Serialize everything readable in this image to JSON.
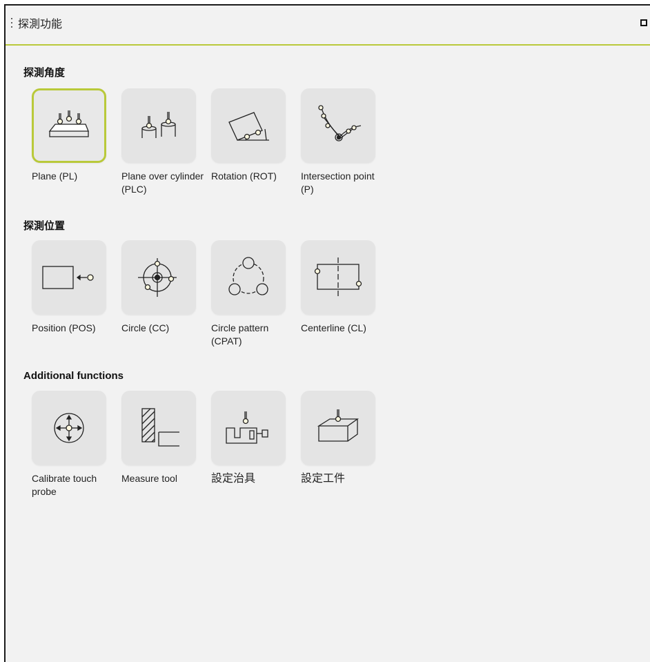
{
  "window": {
    "title": "探測功能",
    "handle_icon": "drag-handle-icon",
    "maximize_icon": "maximize-icon"
  },
  "sections": [
    {
      "title": "探測角度",
      "tiles": [
        {
          "label": "Plane (PL)",
          "icon": "plane-probe-icon",
          "selected": true
        },
        {
          "label": "Plane over cylinder (PLC)",
          "icon": "plane-over-cylinder-icon"
        },
        {
          "label": "Rotation (ROT)",
          "icon": "rotation-probe-icon"
        },
        {
          "label": "Intersection point (P)",
          "icon": "intersection-point-icon"
        }
      ]
    },
    {
      "title": "探測位置",
      "tiles": [
        {
          "label": "Position (POS)",
          "icon": "position-probe-icon"
        },
        {
          "label": "Circle (CC)",
          "icon": "circle-probe-icon"
        },
        {
          "label": "Circle pattern (CPAT)",
          "icon": "circle-pattern-icon"
        },
        {
          "label": "Centerline (CL)",
          "icon": "centerline-probe-icon"
        }
      ]
    },
    {
      "title": "Additional functions",
      "tiles": [
        {
          "label": "Calibrate touch probe",
          "icon": "calibrate-probe-icon"
        },
        {
          "label": "Measure tool",
          "icon": "measure-tool-icon"
        },
        {
          "label": "設定治具",
          "icon": "setup-fixture-icon"
        },
        {
          "label": "設定工件",
          "icon": "setup-workpiece-icon"
        }
      ]
    }
  ],
  "colors": {
    "accent": "#b9c93a",
    "panel_bg": "#f2f2f2",
    "tile_bg": "#e4e4e4"
  }
}
